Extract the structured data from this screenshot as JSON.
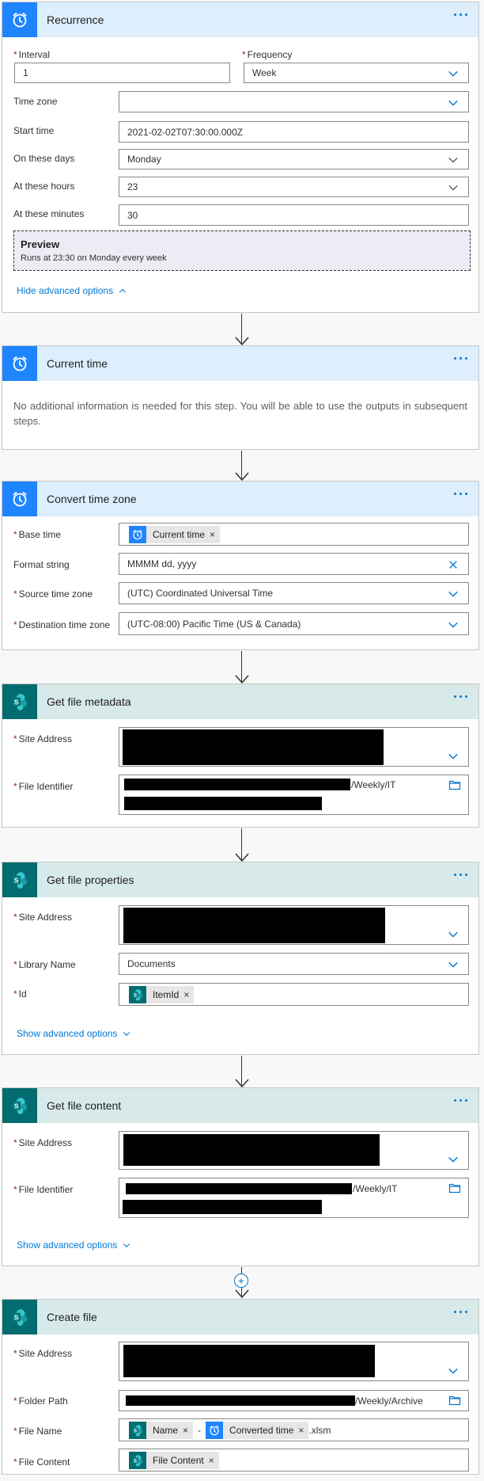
{
  "cards": {
    "recurrence": {
      "title": "Recurrence",
      "interval_label": "Interval",
      "interval_value": "1",
      "frequency_label": "Frequency",
      "frequency_value": "Week",
      "timezone_label": "Time zone",
      "timezone_value": "",
      "start_label": "Start time",
      "start_value": "2021-02-02T07:30:00.000Z",
      "days_label": "On these days",
      "days_value": "Monday",
      "hours_label": "At these hours",
      "hours_value": "23",
      "minutes_label": "At these minutes",
      "minutes_value": "30",
      "preview_title": "Preview",
      "preview_text": "Runs at 23:30 on Monday every week",
      "advanced_link": "Hide advanced options"
    },
    "current_time": {
      "title": "Current time",
      "body": "No additional information is needed for this step. You will be able to use the outputs in subsequent steps."
    },
    "convert": {
      "title": "Convert time zone",
      "base_label": "Base time",
      "base_token": "Current time",
      "format_label": "Format string",
      "format_value": "MMMM dd, yyyy",
      "source_label": "Source time zone",
      "source_value": "(UTC) Coordinated Universal Time",
      "dest_label": "Destination time zone",
      "dest_value": "(UTC-08:00) Pacific Time (US & Canada)"
    },
    "metadata": {
      "title": "Get file metadata",
      "site_label": "Site Address",
      "file_label": "File Identifier",
      "file_suffix": "/Weekly/IT"
    },
    "properties": {
      "title": "Get file properties",
      "site_label": "Site Address",
      "library_label": "Library Name",
      "library_value": "Documents",
      "id_label": "Id",
      "id_token": "ItemId",
      "advanced_link": "Show advanced options"
    },
    "content": {
      "title": "Get file content",
      "site_label": "Site Address",
      "file_label": "File Identifier",
      "file_suffix": "/Weekly/IT",
      "advanced_link": "Show advanced options"
    },
    "create": {
      "title": "Create file",
      "site_label": "Site Address",
      "folder_label": "Folder Path",
      "folder_suffix": "/Weekly/Archive",
      "name_label": "File Name",
      "name_token1": "Name",
      "name_sep": "-",
      "name_token2": "Converted time",
      "name_suffix": ".xlsm",
      "content_label": "File Content",
      "content_token": "File Content"
    }
  },
  "colors": {
    "accent": "#0078d4",
    "clock_icon_bg": "#1f85ff",
    "sharepoint_icon_bg": "#036c70",
    "header_blue": "#ddeefc",
    "header_teal": "#d8e9e9",
    "required": "#a4262c"
  },
  "icons": {
    "clock": "clock-icon",
    "sharepoint": "sharepoint-icon",
    "more": "more-options-icon",
    "chevron": "chevron-down-icon",
    "folder": "folder-icon",
    "clear": "clear-icon"
  }
}
